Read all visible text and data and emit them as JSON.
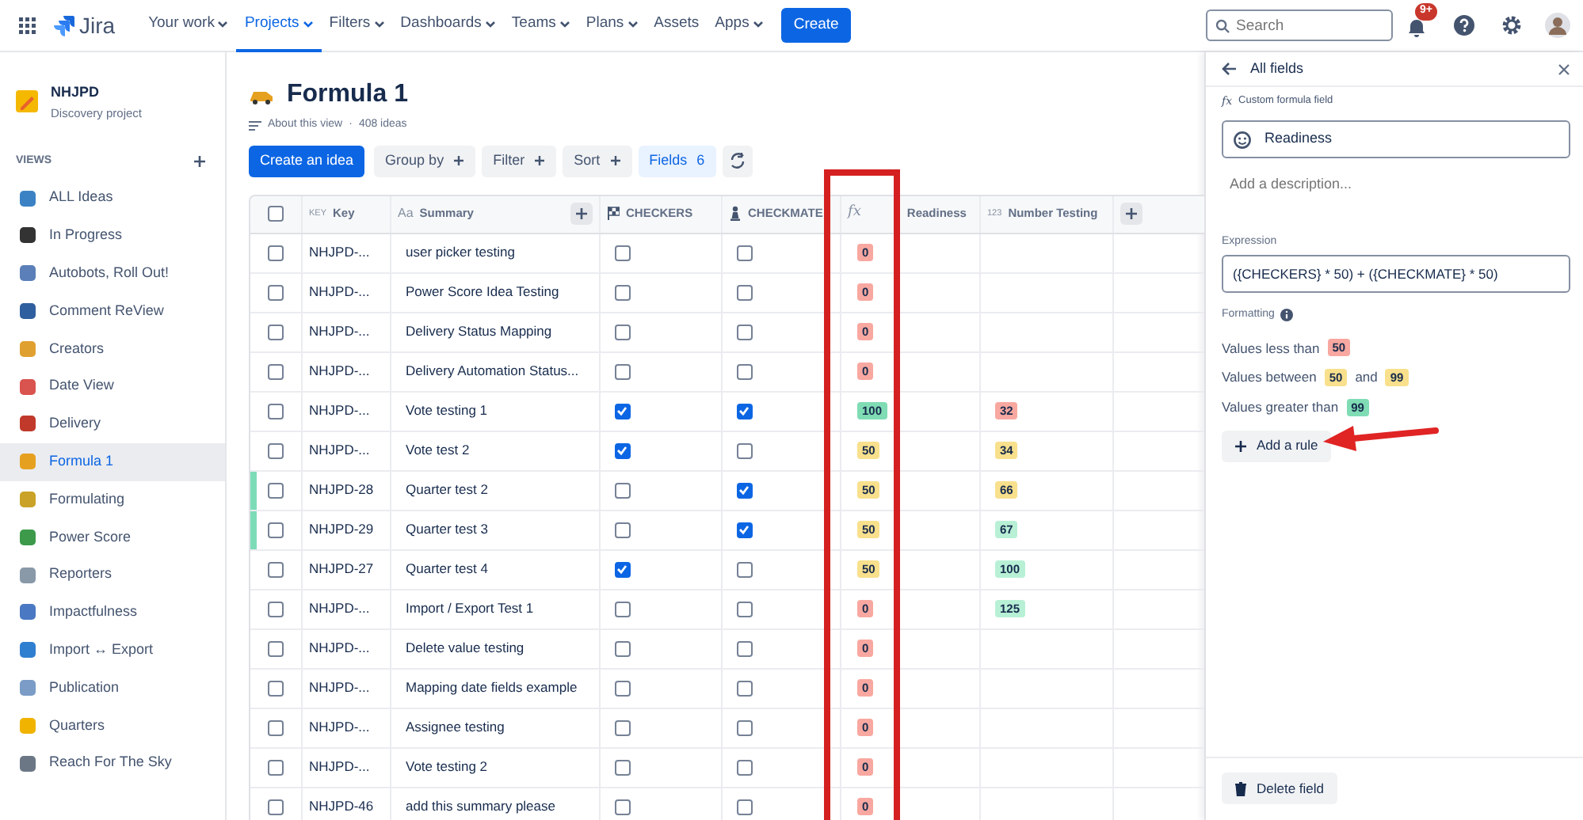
{
  "topbar": {
    "product": "Jira",
    "menu": [
      {
        "label": "Your work",
        "dropdown": true,
        "selected": false
      },
      {
        "label": "Projects",
        "dropdown": true,
        "selected": true
      },
      {
        "label": "Filters",
        "dropdown": true,
        "selected": false
      },
      {
        "label": "Dashboards",
        "dropdown": true,
        "selected": false
      },
      {
        "label": "Teams",
        "dropdown": true,
        "selected": false
      },
      {
        "label": "Plans",
        "dropdown": true,
        "selected": false
      },
      {
        "label": "Assets",
        "dropdown": false,
        "selected": false
      },
      {
        "label": "Apps",
        "dropdown": true,
        "selected": false
      }
    ],
    "create": "Create",
    "search": {
      "placeholder": "Search"
    },
    "notifications": "9+"
  },
  "sidebar": {
    "project": {
      "name": "NHJPD",
      "type": "Discovery project"
    },
    "section": "VIEWS",
    "items": [
      {
        "label": "ALL Ideas",
        "selected": false,
        "color": "#3b82c4"
      },
      {
        "label": "In Progress",
        "selected": false,
        "color": "#333333"
      },
      {
        "label": "Autobots, Roll Out!",
        "selected": false,
        "color": "#5b7fb8"
      },
      {
        "label": "Comment ReView",
        "selected": false,
        "color": "#2f5f9e"
      },
      {
        "label": "Creators",
        "selected": false,
        "color": "#e0a030"
      },
      {
        "label": "Date View",
        "selected": false,
        "color": "#d9534f"
      },
      {
        "label": "Delivery",
        "selected": false,
        "color": "#c0392b"
      },
      {
        "label": "Formula 1",
        "selected": true,
        "color": "#e6a020"
      },
      {
        "label": "Formulating",
        "selected": false,
        "color": "#c9a227"
      },
      {
        "label": "Power Score",
        "selected": false,
        "color": "#3c9a4a"
      },
      {
        "label": "Reporters",
        "selected": false,
        "color": "#8a99a8"
      },
      {
        "label": "Impactfulness",
        "selected": false,
        "color": "#4a78c2"
      },
      {
        "label": "Import ↔ Export",
        "selected": false,
        "color": "#2f7fd0"
      },
      {
        "label": "Publication",
        "selected": false,
        "color": "#7a9cc6"
      },
      {
        "label": "Quarters",
        "selected": false,
        "color": "#f0b400"
      },
      {
        "label": "Reach For The Sky",
        "selected": false,
        "color": "#6b7785"
      }
    ]
  },
  "view": {
    "title": "Formula 1",
    "about": "About this view",
    "separator": "·",
    "count": "408 ideas",
    "create": "Create an idea",
    "buttons": [
      {
        "label": "Group by"
      },
      {
        "label": "Filter"
      },
      {
        "label": "Sort"
      }
    ],
    "fields": {
      "label": "Fields",
      "count": "6"
    }
  },
  "table": {
    "select_all": false,
    "columns": [
      {
        "label": "Key",
        "tag": "KEY"
      },
      {
        "label": "Summary",
        "tag": "Aa"
      },
      {
        "label": "CHECKERS"
      },
      {
        "label": "CHECKMATE"
      },
      {
        "label": "Readiness",
        "tag": "fx"
      },
      {
        "label": "Number Testing",
        "tag": "123"
      }
    ],
    "rows": [
      {
        "selected": false,
        "key": "NHJPD-...",
        "summary": "user picker testing",
        "checkers": false,
        "checkmate": false,
        "highlighted": false,
        "readiness": {
          "value": "0",
          "color": "#f8a8a0"
        }
      },
      {
        "selected": false,
        "key": "NHJPD-...",
        "summary": "Power Score Idea Testing",
        "checkers": false,
        "checkmate": false,
        "highlighted": false,
        "readiness": {
          "value": "0",
          "color": "#f8a8a0"
        }
      },
      {
        "selected": false,
        "key": "NHJPD-...",
        "summary": "Delivery Status Mapping",
        "checkers": false,
        "checkmate": false,
        "highlighted": false,
        "readiness": {
          "value": "0",
          "color": "#f8a8a0"
        }
      },
      {
        "selected": false,
        "key": "NHJPD-...",
        "summary": "Delivery Automation Status...",
        "checkers": false,
        "checkmate": false,
        "highlighted": false,
        "readiness": {
          "value": "0",
          "color": "#f8a8a0"
        }
      },
      {
        "selected": false,
        "key": "NHJPD-...",
        "summary": "Vote testing 1",
        "checkers": true,
        "checkmate": true,
        "highlighted": false,
        "readiness": {
          "value": "100",
          "color": "#7fdcb4"
        },
        "number": {
          "value": "32",
          "color": "#f8a8a0"
        }
      },
      {
        "selected": false,
        "key": "NHJPD-...",
        "summary": "Vote test 2",
        "checkers": true,
        "checkmate": false,
        "highlighted": false,
        "readiness": {
          "value": "50",
          "color": "#f8e08c"
        },
        "number": {
          "value": "34",
          "color": "#f8e08c"
        }
      },
      {
        "selected": false,
        "key": "NHJPD-28",
        "summary": "Quarter test 2",
        "checkers": false,
        "checkmate": true,
        "highlighted": true,
        "readiness": {
          "value": "50",
          "color": "#f8e08c"
        },
        "number": {
          "value": "66",
          "color": "#f8e08c"
        }
      },
      {
        "selected": false,
        "key": "NHJPD-29",
        "summary": "Quarter test 3",
        "checkers": false,
        "checkmate": true,
        "highlighted": true,
        "readiness": {
          "value": "50",
          "color": "#f8e08c"
        },
        "number": {
          "value": "67",
          "color": "#b8f0d6"
        }
      },
      {
        "selected": false,
        "key": "NHJPD-27",
        "summary": "Quarter test 4",
        "checkers": true,
        "checkmate": false,
        "highlighted": false,
        "readiness": {
          "value": "50",
          "color": "#f8e08c"
        },
        "number": {
          "value": "100",
          "color": "#b8f0d6"
        }
      },
      {
        "selected": false,
        "key": "NHJPD-...",
        "summary": "Import / Export Test 1",
        "checkers": false,
        "checkmate": false,
        "highlighted": false,
        "readiness": {
          "value": "0",
          "color": "#f8a8a0"
        },
        "number": {
          "value": "125",
          "color": "#b8f0d6"
        }
      },
      {
        "selected": false,
        "key": "NHJPD-...",
        "summary": "Delete value testing",
        "checkers": false,
        "checkmate": false,
        "highlighted": false,
        "readiness": {
          "value": "0",
          "color": "#f8a8a0"
        }
      },
      {
        "selected": false,
        "key": "NHJPD-...",
        "summary": "Mapping date fields example",
        "checkers": false,
        "checkmate": false,
        "highlighted": false,
        "readiness": {
          "value": "0",
          "color": "#f8a8a0"
        }
      },
      {
        "selected": false,
        "key": "NHJPD-...",
        "summary": "Assignee testing",
        "checkers": false,
        "checkmate": false,
        "highlighted": false,
        "readiness": {
          "value": "0",
          "color": "#f8a8a0"
        }
      },
      {
        "selected": false,
        "key": "NHJPD-...",
        "summary": "Vote testing 2",
        "checkers": false,
        "checkmate": false,
        "highlighted": false,
        "readiness": {
          "value": "0",
          "color": "#f8a8a0"
        }
      },
      {
        "selected": false,
        "key": "NHJPD-46",
        "summary": "add this summary please",
        "checkers": false,
        "checkmate": false,
        "highlighted": false,
        "readiness": {
          "value": "0",
          "color": "#f8a8a0"
        }
      }
    ]
  },
  "panel": {
    "back": "All fields",
    "kind_tag": "fx",
    "kind": "Custom formula field",
    "name": "Readiness",
    "description": {
      "placeholder": "Add a description..."
    },
    "expression_label": "Expression",
    "expression": "({CHECKERS} * 50) + ({CHECKMATE} * 50)",
    "formatting_label": "Formatting",
    "rules": [
      {
        "parts": [
          {
            "text": "Values less than"
          },
          {
            "badge": "50",
            "color": "#f8a8a0"
          }
        ]
      },
      {
        "parts": [
          {
            "text": "Values between"
          },
          {
            "badge": "50",
            "color": "#f8e08c"
          },
          {
            "text": "and"
          },
          {
            "badge": "99",
            "color": "#f8e08c"
          }
        ]
      },
      {
        "parts": [
          {
            "text": "Values greater than"
          },
          {
            "badge": "99",
            "color": "#7fdcb4"
          }
        ]
      }
    ],
    "add_rule": "Add a rule",
    "delete": "Delete field"
  }
}
